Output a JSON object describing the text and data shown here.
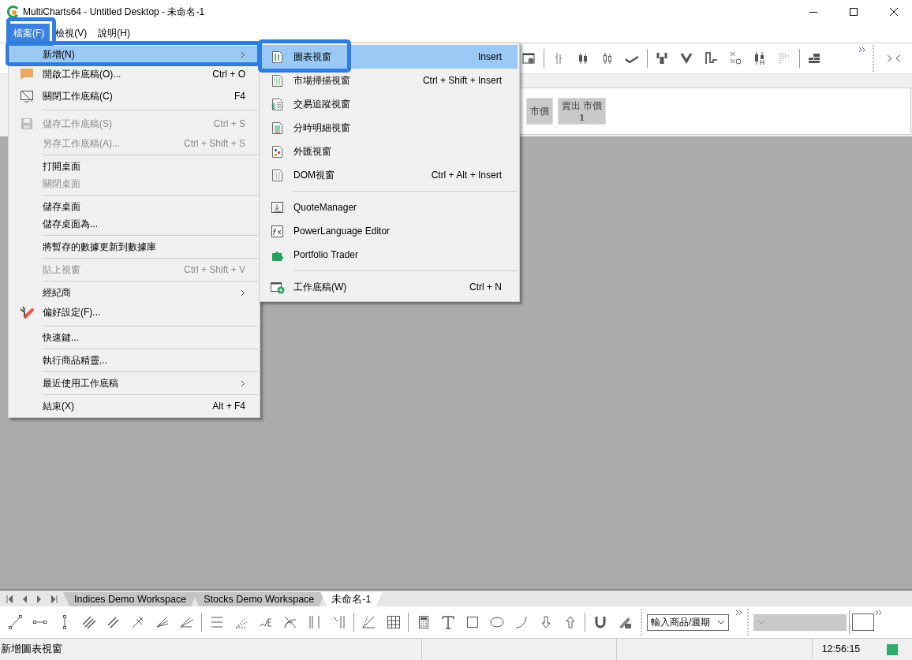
{
  "window": {
    "title": "MultiCharts64 - Untitled Desktop - 未命名-1"
  },
  "menubar": [
    {
      "label": "檔案(F)",
      "selected": true
    },
    {
      "label": "檢視(V)",
      "selected": false
    },
    {
      "label": "說明(H)",
      "selected": false
    }
  ],
  "file_menu": [
    {
      "kind": "item",
      "label": "新增(N)",
      "submenu": true,
      "selected": true,
      "disabled": false
    },
    {
      "kind": "item",
      "label": "開啟工作底稿(O)...",
      "shortcut": "Ctrl + O",
      "submenu": false,
      "selected": false,
      "disabled": false
    },
    {
      "kind": "item",
      "label": "關閉工作底稿(C)",
      "shortcut": "F4",
      "submenu": false,
      "selected": false,
      "disabled": false
    },
    {
      "kind": "separator"
    },
    {
      "kind": "item",
      "label": "儲存工作底稿(S)",
      "shortcut": "Ctrl + S",
      "submenu": false,
      "selected": false,
      "disabled": true
    },
    {
      "kind": "item",
      "label": "另存工作底稿(A)...",
      "shortcut": "Ctrl + Shift + S",
      "submenu": false,
      "selected": false,
      "disabled": true
    },
    {
      "kind": "separator"
    },
    {
      "kind": "item",
      "label": "打開桌面",
      "submenu": false,
      "selected": false,
      "disabled": false
    },
    {
      "kind": "item",
      "label": "關閉桌面",
      "submenu": false,
      "selected": false,
      "disabled": true
    },
    {
      "kind": "separator"
    },
    {
      "kind": "item",
      "label": "儲存桌面",
      "submenu": false,
      "selected": false,
      "disabled": false
    },
    {
      "kind": "item",
      "label": "儲存桌面為...",
      "submenu": false,
      "selected": false,
      "disabled": false
    },
    {
      "kind": "separator"
    },
    {
      "kind": "item",
      "label": "將暫存的數據更新到數據庫",
      "submenu": false,
      "selected": false,
      "disabled": false
    },
    {
      "kind": "separator"
    },
    {
      "kind": "item",
      "label": "貼上視窗",
      "shortcut": "Ctrl + Shift + V",
      "submenu": false,
      "selected": false,
      "disabled": true
    },
    {
      "kind": "separator"
    },
    {
      "kind": "item",
      "label": "經紀商",
      "submenu": true,
      "selected": false,
      "disabled": false
    },
    {
      "kind": "item",
      "label": "偏好設定(F)...",
      "submenu": false,
      "selected": false,
      "disabled": false
    },
    {
      "kind": "separator"
    },
    {
      "kind": "item",
      "label": "快速鍵...",
      "submenu": false,
      "selected": false,
      "disabled": false
    },
    {
      "kind": "separator"
    },
    {
      "kind": "item",
      "label": "執行商品精靈...",
      "submenu": false,
      "selected": false,
      "disabled": false
    },
    {
      "kind": "separator"
    },
    {
      "kind": "item",
      "label": "最近使用工作底稿",
      "submenu": true,
      "selected": false,
      "disabled": false
    },
    {
      "kind": "separator"
    },
    {
      "kind": "item",
      "label": "結束(X)",
      "shortcut": "Alt + F4",
      "submenu": false,
      "selected": false,
      "disabled": false
    }
  ],
  "new_submenu": [
    {
      "kind": "item",
      "label": "圖表視窗",
      "shortcut": "Insert",
      "selected": true
    },
    {
      "kind": "item",
      "label": "市場掃描視窗",
      "shortcut": "Ctrl + Shift + Insert",
      "selected": false
    },
    {
      "kind": "item",
      "label": "交易追蹤視窗",
      "selected": false
    },
    {
      "kind": "item",
      "label": "分時明細視窗",
      "selected": false
    },
    {
      "kind": "item",
      "label": "外匯視窗",
      "selected": false
    },
    {
      "kind": "item",
      "label": "DOM視窗",
      "shortcut": "Ctrl + Alt + Insert",
      "selected": false
    },
    {
      "kind": "separator"
    },
    {
      "kind": "item",
      "label": "QuoteManager",
      "selected": false
    },
    {
      "kind": "item",
      "label": "PowerLanguage Editor",
      "selected": false
    },
    {
      "kind": "item",
      "label": "Portfolio Trader",
      "selected": false
    },
    {
      "kind": "separator"
    },
    {
      "kind": "item",
      "label": "工作底稿(W)",
      "shortcut": "Ctrl + N",
      "selected": false
    }
  ],
  "order_buttons": [
    {
      "label": "市價"
    },
    {
      "label": "賣出 市價",
      "quantity": "1"
    }
  ],
  "workspace_tabs": [
    {
      "label": "Indices Demo Workspace",
      "selected": false
    },
    {
      "label": "Stocks Demo Workspace",
      "selected": false
    },
    {
      "label": "未命名-1",
      "selected": true
    }
  ],
  "symbol_combo": {
    "value": "輸入商品/週期"
  },
  "status_bar": {
    "message": "新增圖表視窗",
    "time": "12:56:15"
  }
}
